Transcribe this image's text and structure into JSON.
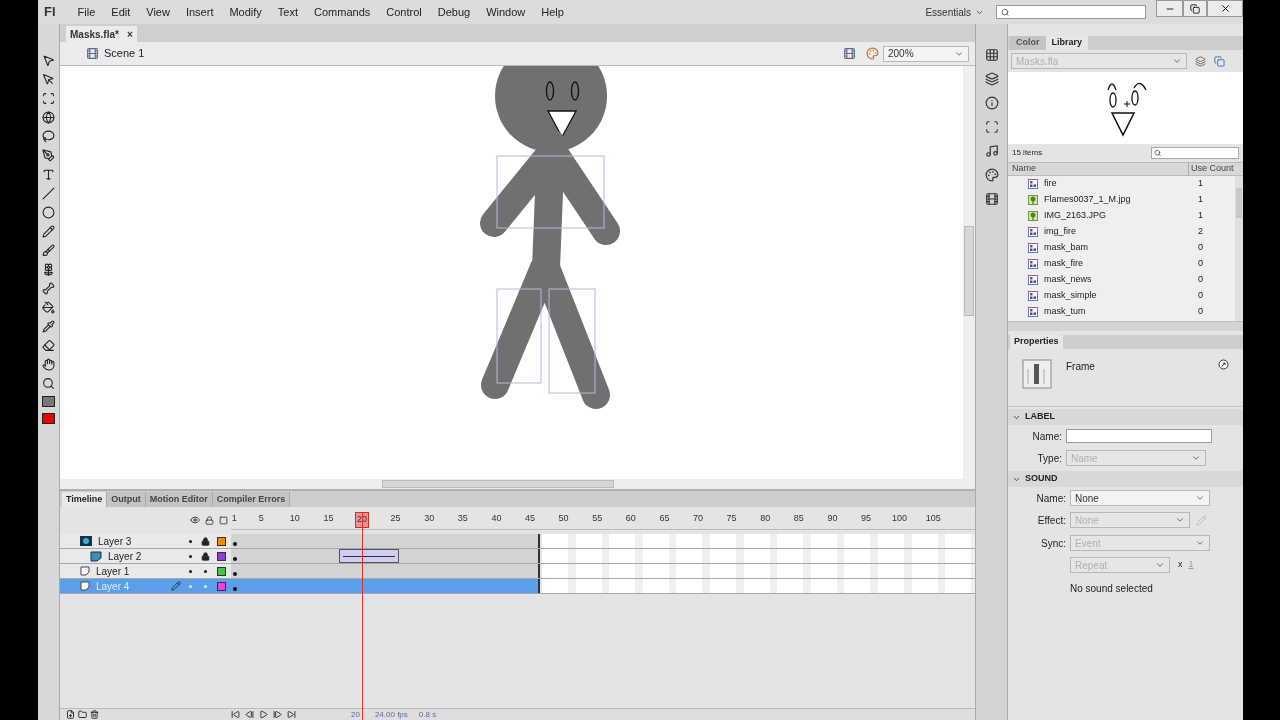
{
  "app": {
    "logo": "Fl"
  },
  "menu": [
    "File",
    "Edit",
    "View",
    "Insert",
    "Modify",
    "Text",
    "Commands",
    "Control",
    "Debug",
    "Window",
    "Help"
  ],
  "workspace": {
    "label": "Essentials"
  },
  "document_tab": {
    "title": "Masks.fla*",
    "close": "×"
  },
  "scene": {
    "name": "Scene 1",
    "zoom": "200%"
  },
  "timeline": {
    "tabs": [
      {
        "label": "Timeline",
        "selected": true
      },
      {
        "label": "Output",
        "selected": false
      },
      {
        "label": "Motion Editor",
        "selected": false
      },
      {
        "label": "Compiler Errors",
        "selected": false
      }
    ],
    "ruler": [
      {
        "label": "1",
        "selected": false
      },
      {
        "label": "5",
        "selected": false
      },
      {
        "label": "10",
        "selected": false
      },
      {
        "label": "15",
        "selected": false
      },
      {
        "label": "20",
        "selected": true
      },
      {
        "label": "25",
        "selected": false
      },
      {
        "label": "30",
        "selected": false
      },
      {
        "label": "35",
        "selected": false
      },
      {
        "label": "40",
        "selected": false
      },
      {
        "label": "45",
        "selected": false
      },
      {
        "label": "50",
        "selected": false
      },
      {
        "label": "55",
        "selected": false
      },
      {
        "label": "60",
        "selected": false
      },
      {
        "label": "65",
        "selected": false
      },
      {
        "label": "70",
        "selected": false
      },
      {
        "label": "75",
        "selected": false
      },
      {
        "label": "80",
        "selected": false
      },
      {
        "label": "85",
        "selected": false
      },
      {
        "label": "90",
        "selected": false
      },
      {
        "label": "95",
        "selected": false
      },
      {
        "label": "100",
        "selected": false
      },
      {
        "label": "105",
        "selected": false
      }
    ],
    "layers": [
      {
        "name": "Layer 3",
        "kind": "mask",
        "locked": true,
        "color": "#f08a00",
        "selected": false,
        "tween": false,
        "children": [
          {
            "name": "Layer 2",
            "kind": "masked",
            "locked": true,
            "color": "#9040d0",
            "selected": false,
            "tween": true
          }
        ]
      },
      {
        "name": "Layer 1",
        "kind": "normal",
        "locked": false,
        "color": "#40c840",
        "selected": false,
        "tween": false
      },
      {
        "name": "Layer 4",
        "kind": "normal",
        "locked": false,
        "color": "#f040e0",
        "selected": true,
        "tween": false
      }
    ],
    "status": {
      "frame": "20",
      "fps": "24.00 fps",
      "time": "0.8 s"
    }
  },
  "panels": {
    "tabs": [
      {
        "label": "Color",
        "selected": false
      },
      {
        "label": "Library",
        "selected": true
      }
    ]
  },
  "library": {
    "document": "Masks.fla",
    "count": "15 items",
    "columns": [
      "Name",
      "Use Count"
    ],
    "items": [
      {
        "name": "fire",
        "kind": "symbol",
        "use_count": "1"
      },
      {
        "name": "Flames0037_1_M.jpg",
        "kind": "bitmap",
        "use_count": "1"
      },
      {
        "name": "IMG_2163.JPG",
        "kind": "bitmap",
        "use_count": "1"
      },
      {
        "name": "img_fire",
        "kind": "symbol",
        "use_count": "2"
      },
      {
        "name": "mask_bam",
        "kind": "symbol",
        "use_count": "0"
      },
      {
        "name": "mask_fire",
        "kind": "symbol",
        "use_count": "0"
      },
      {
        "name": "mask_news",
        "kind": "symbol",
        "use_count": "0"
      },
      {
        "name": "mask_simple",
        "kind": "symbol",
        "use_count": "0"
      },
      {
        "name": "mask_tum",
        "kind": "symbol",
        "use_count": "0"
      }
    ]
  },
  "properties": {
    "title": "Properties",
    "object": "Frame",
    "label_section": {
      "title": "LABEL",
      "name_label": "Name:",
      "type_label": "Type:",
      "type_value": "Name"
    },
    "sound_section": {
      "title": "SOUND",
      "name_label": "Name:",
      "name_value": "None",
      "effect_label": "Effect:",
      "effect_value": "None",
      "sync_label": "Sync:",
      "sync_value": "Event",
      "repeat_value": "Repeat",
      "times_sign": "x",
      "repeat_count": "1",
      "note": "No sound selected"
    }
  }
}
